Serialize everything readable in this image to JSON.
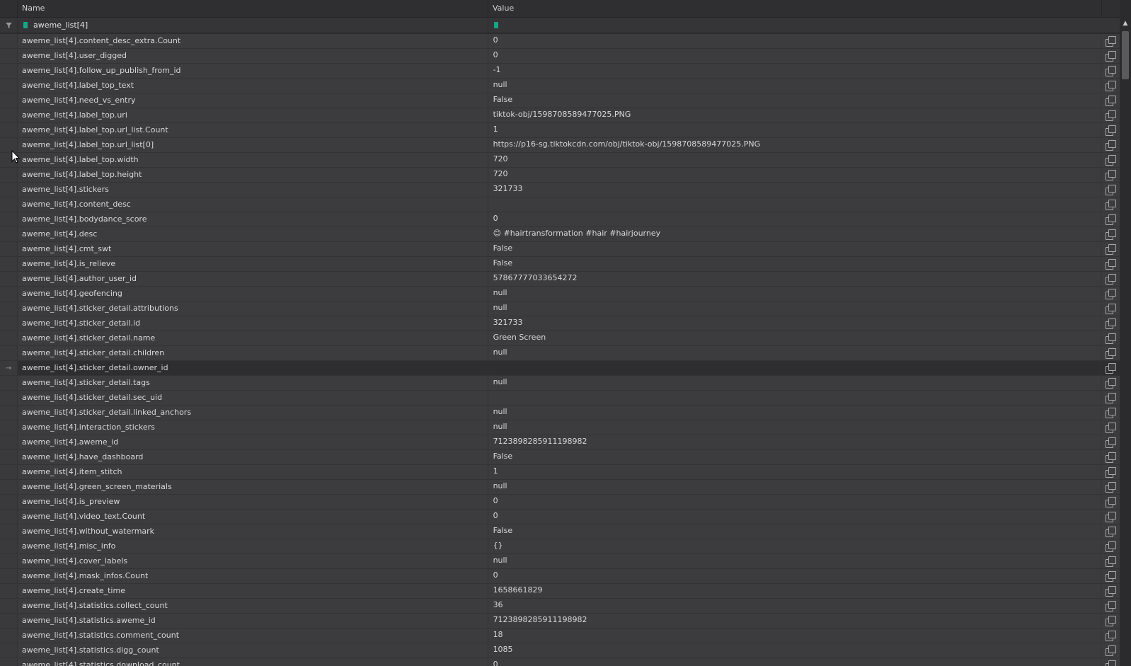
{
  "header": {
    "name": "Name",
    "value": "Value"
  },
  "filter": {
    "name_text": "aweme_list[4]",
    "value_text": ""
  },
  "rows": [
    {
      "name": "aweme_list[4].content_desc_extra.Count",
      "value": "0"
    },
    {
      "name": "aweme_list[4].user_digged",
      "value": "0"
    },
    {
      "name": "aweme_list[4].follow_up_publish_from_id",
      "value": "-1"
    },
    {
      "name": "aweme_list[4].label_top_text",
      "value": "null"
    },
    {
      "name": "aweme_list[4].need_vs_entry",
      "value": "False"
    },
    {
      "name": "aweme_list[4].label_top.uri",
      "value": "tiktok-obj/1598708589477025.PNG"
    },
    {
      "name": "aweme_list[4].label_top.url_list.Count",
      "value": "1"
    },
    {
      "name": "aweme_list[4].label_top.url_list[0]",
      "value": "https://p16-sg.tiktokcdn.com/obj/tiktok-obj/1598708589477025.PNG"
    },
    {
      "name": "aweme_list[4].label_top.width",
      "value": "720"
    },
    {
      "name": "aweme_list[4].label_top.height",
      "value": "720"
    },
    {
      "name": "aweme_list[4].stickers",
      "value": "321733"
    },
    {
      "name": "aweme_list[4].content_desc",
      "value": ""
    },
    {
      "name": "aweme_list[4].bodydance_score",
      "value": "0"
    },
    {
      "name": "aweme_list[4].desc",
      "value": "😊 #hairtransformation #hair #hairjourney"
    },
    {
      "name": "aweme_list[4].cmt_swt",
      "value": "False"
    },
    {
      "name": "aweme_list[4].is_relieve",
      "value": "False"
    },
    {
      "name": "aweme_list[4].author_user_id",
      "value": "578677770336542​72"
    },
    {
      "name": "aweme_list[4].geofencing",
      "value": "null"
    },
    {
      "name": "aweme_list[4].sticker_detail.attributions",
      "value": "null"
    },
    {
      "name": "aweme_list[4].sticker_detail.id",
      "value": "321733"
    },
    {
      "name": "aweme_list[4].sticker_detail.name",
      "value": "Green Screen"
    },
    {
      "name": "aweme_list[4].sticker_detail.children",
      "value": "null"
    },
    {
      "name": "aweme_list[4].sticker_detail.owner_id",
      "value": "",
      "selected": true
    },
    {
      "name": "aweme_list[4].sticker_detail.tags",
      "value": "null"
    },
    {
      "name": "aweme_list[4].sticker_detail.sec_uid",
      "value": ""
    },
    {
      "name": "aweme_list[4].sticker_detail.linked_anchors",
      "value": "null"
    },
    {
      "name": "aweme_list[4].interaction_stickers",
      "value": "null"
    },
    {
      "name": "aweme_list[4].aweme_id",
      "value": "7123898285911198982"
    },
    {
      "name": "aweme_list[4].have_dashboard",
      "value": "False"
    },
    {
      "name": "aweme_list[4].item_stitch",
      "value": "1"
    },
    {
      "name": "aweme_list[4].green_screen_materials",
      "value": "null"
    },
    {
      "name": "aweme_list[4].is_preview",
      "value": "0"
    },
    {
      "name": "aweme_list[4].video_text.Count",
      "value": "0"
    },
    {
      "name": "aweme_list[4].without_watermark",
      "value": "False"
    },
    {
      "name": "aweme_list[4].misc_info",
      "value": "{}"
    },
    {
      "name": "aweme_list[4].cover_labels",
      "value": "null"
    },
    {
      "name": "aweme_list[4].mask_infos.Count",
      "value": "0"
    },
    {
      "name": "aweme_list[4].create_time",
      "value": "1658661829"
    },
    {
      "name": "aweme_list[4].statistics.collect_count",
      "value": "36"
    },
    {
      "name": "aweme_list[4].statistics.aweme_id",
      "value": "7123898285911198982"
    },
    {
      "name": "aweme_list[4].statistics.comment_count",
      "value": "18"
    },
    {
      "name": "aweme_list[4].statistics.digg_count",
      "value": "1085"
    },
    {
      "name": "aweme_list[4].statistics.download_count",
      "value": "0"
    }
  ],
  "icons": {
    "filter": "filter-funnel-icon",
    "copy": "copy-icon",
    "row_pointer": "arrow-right-icon",
    "scroll_up": "triangle-up-icon"
  },
  "colors": {
    "background": "#3c3c3e",
    "header": "#2f2f31",
    "selected_row": "#2e2e30",
    "accent": "#17a589"
  }
}
